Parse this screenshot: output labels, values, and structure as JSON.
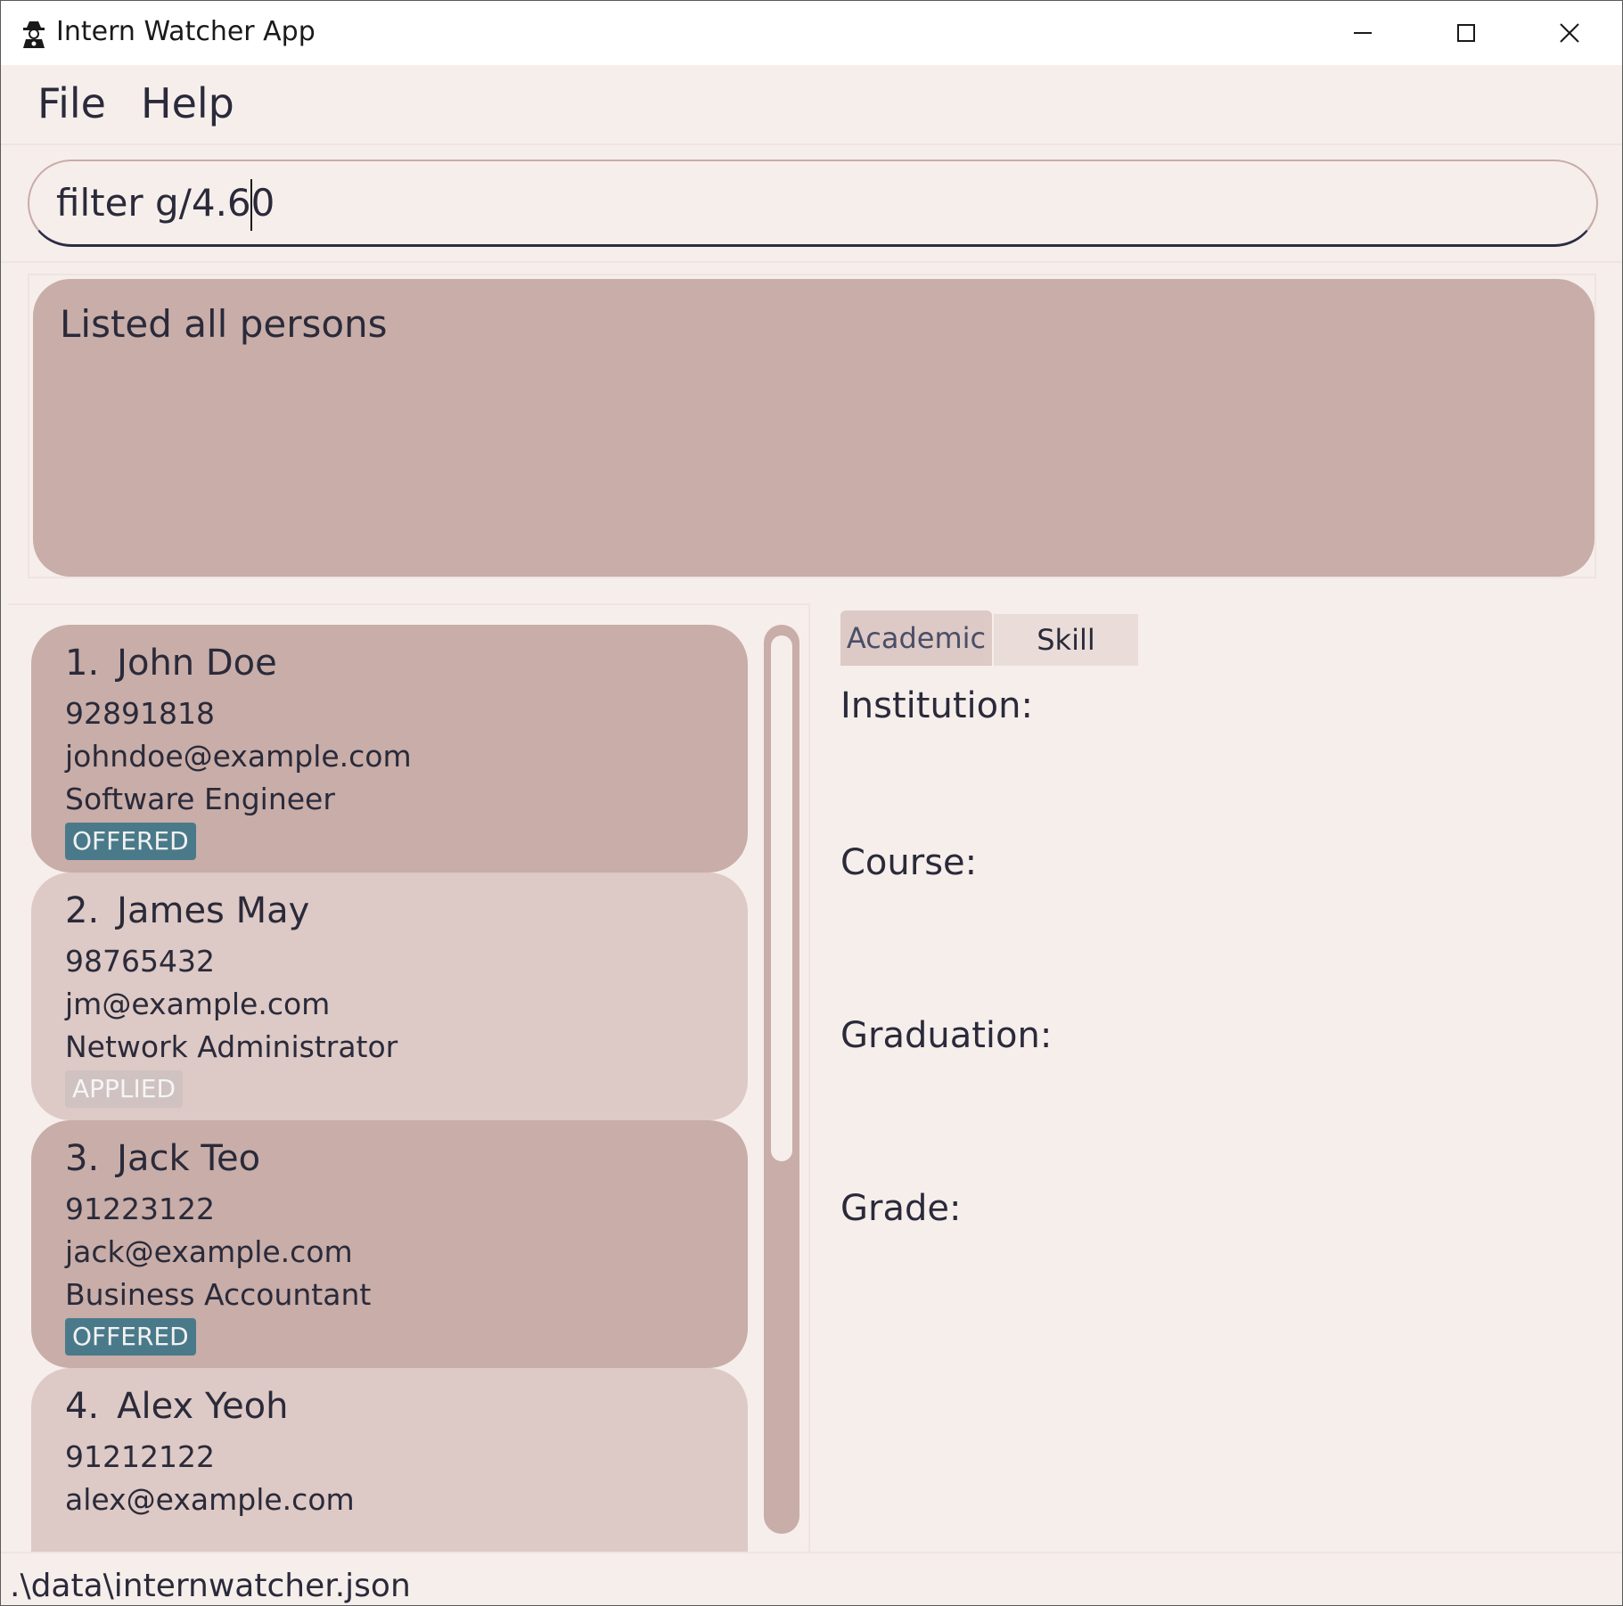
{
  "window": {
    "title": "Intern Watcher App",
    "icon": "detective-icon"
  },
  "menu": {
    "file": "File",
    "help": "Help"
  },
  "command": {
    "value": "filter g/4.60"
  },
  "result": {
    "message": "Listed all persons"
  },
  "persons": [
    {
      "index": "1.",
      "name": "John Doe",
      "phone": "92891818",
      "email": "johndoe@example.com",
      "role": "Software Engineer",
      "status": "OFFERED"
    },
    {
      "index": "2.",
      "name": "James May",
      "phone": "98765432",
      "email": "jm@example.com",
      "role": "Network Administrator",
      "status": "APPLIED"
    },
    {
      "index": "3.",
      "name": "Jack Teo",
      "phone": "91223122",
      "email": "jack@example.com",
      "role": "Business Accountant",
      "status": "OFFERED"
    },
    {
      "index": "4.",
      "name": "Alex Yeoh",
      "phone": "91212122",
      "email": "alex@example.com"
    }
  ],
  "details": {
    "tabs": {
      "academic": "Academic",
      "skill": "Skill"
    },
    "institution_label": "Institution:",
    "course_label": "Course:",
    "graduation_label": "Graduation:",
    "grade_label": "Grade:"
  },
  "status": {
    "file_path": ".\\data\\internwatcher.json"
  },
  "colors": {
    "background": "#f6eeeb",
    "card_dark": "#c8ada8",
    "card_light": "#ddc9c5",
    "offered_tag": "#4a7a8a",
    "applied_tag": "#cfc2c0"
  }
}
